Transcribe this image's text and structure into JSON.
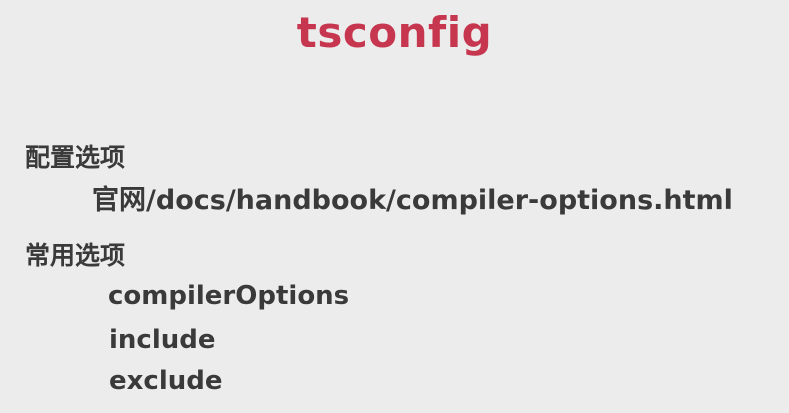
{
  "slide": {
    "title": "tsconfig",
    "config_heading": "配置选项",
    "config_url": "官网/docs/handbook/compiler-options.html",
    "common_heading": "常用选项",
    "common_options": [
      "compilerOptions",
      "include",
      "exclude"
    ]
  },
  "colors": {
    "title": "#c7364f",
    "text": "#3a3a3a",
    "background": "#ececec"
  }
}
